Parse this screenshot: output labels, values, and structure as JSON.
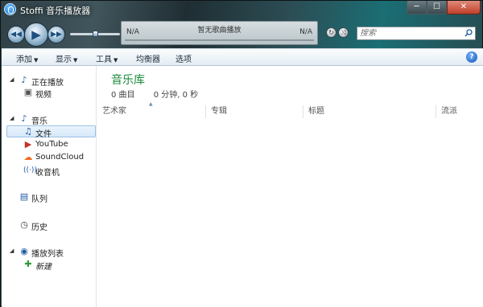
{
  "window": {
    "title": "Stoffi 音乐播放器",
    "minimize": "─",
    "maximize": "☐",
    "close": "✕"
  },
  "player": {
    "left_label": "N/A",
    "now_playing": "暂无歌曲播放",
    "right_label": "N/A",
    "prev_icon": "◀◀",
    "play_icon": "▶",
    "next_icon": "▶▶",
    "seek_position": 0.5,
    "repeat_icon": "↻",
    "shuffle_icon": "⤨"
  },
  "search": {
    "placeholder": "搜索"
  },
  "menu": {
    "add": "添加",
    "view": "显示",
    "tools": "工具",
    "equalizer": "均衡器",
    "options": "选项",
    "help": "?"
  },
  "sidebar": {
    "now_playing": "正在播放",
    "video": "视频",
    "music": "音乐",
    "files": "文件",
    "youtube": "YouTube",
    "soundcloud": "SoundCloud",
    "radio": "收音机",
    "queue": "队列",
    "history": "历史",
    "playlists": "播放列表",
    "new": "新建"
  },
  "library": {
    "title": "音乐库",
    "track_count": "0 曲目",
    "duration": "0 分钟, 0 秒",
    "columns": [
      "艺术家",
      "专辑",
      "标题",
      "流派"
    ]
  },
  "colors": {
    "accent_green": "#1b8a3c",
    "selection": "#d6e8f8"
  }
}
